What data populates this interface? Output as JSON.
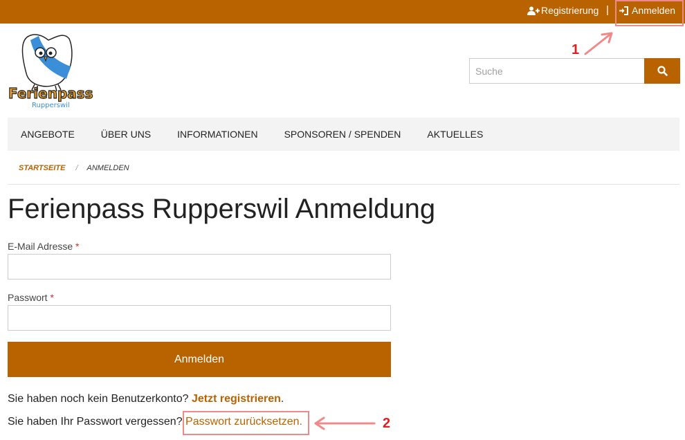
{
  "topbar": {
    "register_label": "Registrierung",
    "login_label": "Anmelden",
    "separator": "|"
  },
  "logo": {
    "brand_text": "Ferienpass",
    "sub_text": "Rupperswil"
  },
  "search": {
    "placeholder": "Suche"
  },
  "nav": {
    "items": [
      "ANGEBOTE",
      "ÜBER UNS",
      "INFORMATIONEN",
      "SPONSOREN / SPENDEN",
      "AKTUELLES"
    ]
  },
  "breadcrumb": {
    "home": "STARTSEITE",
    "separator": "/",
    "current": "ANMELDEN"
  },
  "page": {
    "title": "Ferienpass Rupperswil Anmeldung"
  },
  "form": {
    "email_label": "E-Mail Adresse",
    "password_label": "Passwort",
    "required_mark": "*",
    "submit_label": "Anmelden"
  },
  "info": {
    "no_account_text": "Sie haben noch kein Benutzerkonto?",
    "register_link": "Jetzt registrieren",
    "register_suffix": ".",
    "forgot_text": "Sie haben Ihr Passwort vergessen?",
    "reset_link": "Passwort zurücksetzen."
  },
  "annotations": {
    "first": "1",
    "second": "2"
  },
  "colors": {
    "brand": "#b86200",
    "annotation": "#f08a8a",
    "annotation_text": "#e02020"
  }
}
